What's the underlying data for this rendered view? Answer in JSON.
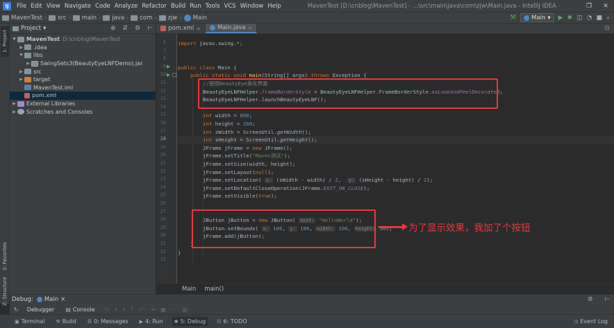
{
  "menubar": {
    "items": [
      "File",
      "Edit",
      "View",
      "Navigate",
      "Code",
      "Analyze",
      "Refactor",
      "Build",
      "Run",
      "Tools",
      "VCS",
      "Window",
      "Help"
    ],
    "window_title": "MavenTest [D:\\cnblog\\MavenTest] - ...\\src\\main\\java\\com\\zjw\\Main.java - IntelliJ IDEA",
    "restore": "❐",
    "close": "✕"
  },
  "navbar": {
    "crumbs": [
      "MavenTest",
      "src",
      "main",
      "java",
      "com",
      "zjw",
      "Main"
    ],
    "run_config": "Main"
  },
  "left_strip": {
    "project": "1: Project",
    "favorites": "2: Favorites",
    "structure": "Z: Structure"
  },
  "project_panel": {
    "title": "Project",
    "tree": [
      {
        "label": "MavenTest",
        "path": "D:\\cnblog\\MavenTest",
        "arrow": "▼",
        "icon": "folder"
      },
      {
        "label": ".idea",
        "path": "",
        "arrow": "▶",
        "icon": "folder"
      },
      {
        "label": "libs",
        "path": "",
        "arrow": "▼",
        "icon": "folder"
      },
      {
        "label": "SwingSets3(BeautyEyeLNFDemo).jar",
        "path": "",
        "arrow": "▶",
        "icon": "jar"
      },
      {
        "label": "src",
        "path": "",
        "arrow": "▶",
        "icon": "folder"
      },
      {
        "label": "target",
        "path": "",
        "arrow": "▶",
        "icon": "folder-orange"
      },
      {
        "label": "MavenTest.iml",
        "path": "",
        "arrow": "",
        "icon": "iml"
      },
      {
        "label": "pom.xml",
        "path": "",
        "arrow": "",
        "icon": "maven"
      },
      {
        "label": "External Libraries",
        "path": "",
        "arrow": "▶",
        "icon": "lib"
      },
      {
        "label": "Scratches and Consoles",
        "path": "",
        "arrow": "▶",
        "icon": "scratch"
      }
    ]
  },
  "editor_tabs": [
    {
      "label": "pom.xml",
      "active": false
    },
    {
      "label": "Main.java",
      "active": true
    }
  ],
  "editor": {
    "line_numbers": [
      "6",
      "7",
      "8",
      "9",
      "10",
      "11",
      "12",
      "13",
      "14",
      "15",
      "16",
      "17",
      "18",
      "19",
      "20",
      "21",
      "22",
      "23",
      "24",
      "25",
      "26",
      "27",
      "28",
      "29",
      "30",
      "31",
      "32",
      "33"
    ],
    "breadcrumb": [
      "Main",
      "main()"
    ]
  },
  "code": {
    "l6_kw": "import",
    "l6_rest": " javax.swing.*;",
    "l9_kw": "public class",
    "l9_rest": " Main {",
    "l10_kw1": "public static void",
    "l10_fn": "main",
    "l10_args": "(String[] args) ",
    "l10_kw2": "throws",
    "l10_rest": " Exception {",
    "l11_cmt": "//使用BeautyEye美化界面",
    "l12_a": "BeautyEyeLNFHelper.",
    "l12_b": "frameBorderStyle",
    "l12_c": " = BeautyEyeLNFHelper.FrameBorderStyle.",
    "l12_d": "osLookAndFeelDecorated",
    "l12_e": ";",
    "l13_a": "BeautyEyeLNFHelper.",
    "l13_b": "launchBeautyEyeLNF",
    "l13_c": "();",
    "l15_kw": "int",
    "l15_a": " width = ",
    "l15_num": "600",
    "l15_e": ";",
    "l16_kw": "int",
    "l16_a": " height = ",
    "l16_num": "200",
    "l16_e": ";",
    "l17_kw": "int",
    "l17_a": " sWidth = ScreenUtil.",
    "l17_b": "getWidth",
    "l17_c": "();",
    "l18_kw": "int",
    "l18_a": " sHeight = ScreenUtil.",
    "l18_b": "getHeight",
    "l18_c": "();",
    "l19_a": "JFrame jFrame = ",
    "l19_kw": "new",
    "l19_b": " JFrame();",
    "l20_a": "jFrame.setTitle(",
    "l20_str": "\"Maven测试\"",
    "l20_b": ");",
    "l21": "jFrame.setSize(width, height);",
    "l22_a": "jFrame.setLayout(",
    "l22_kw": "null",
    "l22_b": ");",
    "l23_a": "jFrame.setLocation( ",
    "l23_h1": "x:",
    "l23_b": " (sWidth - width) / ",
    "l23_n1": "2",
    "l23_c": ",  ",
    "l23_h2": "y:",
    "l23_d": " (sHeight - height) / ",
    "l23_n2": "2",
    "l23_e": ");",
    "l24_a": "jFrame.setDefaultCloseOperation(JFrame.",
    "l24_b": "EXIT_ON_CLOSE",
    "l24_c": ");",
    "l25_a": "jFrame.setVisible(",
    "l25_kw": "true",
    "l25_b": ");",
    "l28_a": "JButton jButton = ",
    "l28_kw": "new",
    "l28_b": " JButton( ",
    "l28_h": "text:",
    "l28_str": " \"HelloWorld\"",
    "l28_c": ");",
    "l29_a": "jButton.setBounds( ",
    "l29_h1": "x:",
    "l29_n1": " 100",
    "l29_b": ", ",
    "l29_h2": "y:",
    "l29_n2": " 100",
    "l29_c": ", ",
    "l29_h3": "width:",
    "l29_n3": " 100",
    "l29_d": ", ",
    "l29_h4": "height:",
    "l29_n4": " 30",
    "l29_e": ");",
    "l30": "jFrame.add(jButton);",
    "l31": "}",
    "l32": "}"
  },
  "annotation": "为了显示效果，我加了个按钮",
  "debug": {
    "label": "Debug:",
    "config": "Main",
    "close": "×",
    "debugger": "Debugger",
    "console": "Console"
  },
  "bottom_tools": {
    "terminal": "Terminal",
    "build": "Build",
    "messages": "0: Messages",
    "run": "4: Run",
    "debug": "5: Debug",
    "todo": "6: TODO",
    "event_log": "Event Log"
  },
  "colors": {
    "annotation": "#e8383d",
    "keyword": "#cc7832",
    "string": "#6a8759",
    "number": "#6897bb"
  }
}
